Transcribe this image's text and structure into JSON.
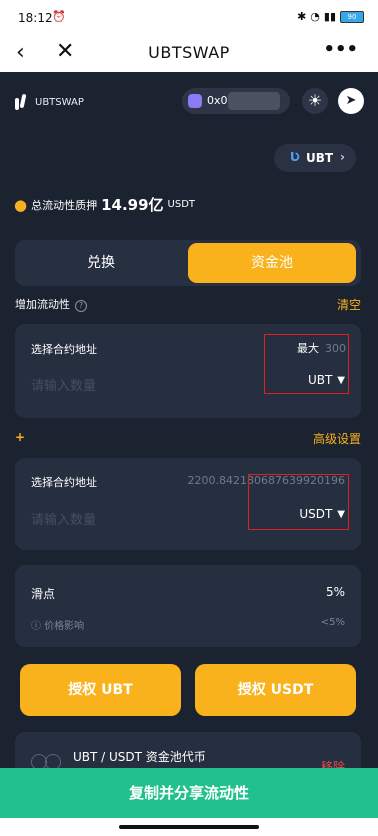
{
  "status_bar": {
    "time": "18:12",
    "alarm_icon": "alarm-icon",
    "battery": "90"
  },
  "title_bar": {
    "title": "UBTSWAP",
    "back_icon": "chevron-left-icon",
    "close_icon": "close-icon",
    "more": "•••"
  },
  "header": {
    "logo_text": "UBTSWAP",
    "wallet_address": "0x0",
    "ubt_button": "UBT"
  },
  "tvl": {
    "label": "总流动性质押",
    "value": "14.99亿",
    "unit": "USDT"
  },
  "tabs": [
    {
      "label": "兑换"
    },
    {
      "label": "资金池"
    }
  ],
  "add_liquidity": {
    "label": "增加流动性",
    "clear": "清空"
  },
  "input_a": {
    "label": "选择合约地址",
    "placeholder": "请输入数量",
    "max_label": "最大",
    "max_value": "300",
    "token": "UBT"
  },
  "plus_row": {
    "plus": "+",
    "advanced": "高级设置"
  },
  "input_b": {
    "label": "选择合约地址",
    "balance": "2200.842180687639920196",
    "placeholder": "请输入数量",
    "token": "USDT"
  },
  "slippage": {
    "label": "滑点",
    "value": "5%",
    "impact_label": "价格影响",
    "impact_value": "<5%"
  },
  "buttons": {
    "approve_a": "授权 UBT",
    "approve_b": "授权 USDT"
  },
  "pool": {
    "name": "UBT / USDT 资金池代币",
    "remove": "移除"
  },
  "bottom_button": "复制并分享流动性",
  "colors": {
    "accent": "#f9b21b",
    "green": "#22c08d",
    "background": "#1b2230",
    "card": "#262f3f"
  }
}
